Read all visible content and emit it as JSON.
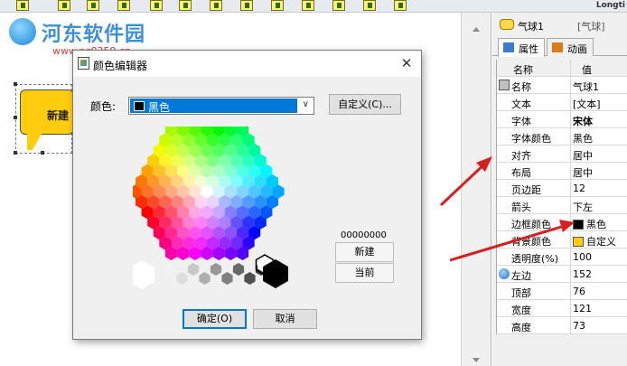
{
  "toolbar": {
    "right_text": "Longti"
  },
  "watermark": {
    "title": "河东软件园",
    "url": "www.pc0359.cn"
  },
  "canvas": {
    "balloon_text": "新建",
    "balloon_color": "#ffcc10"
  },
  "panel": {
    "object_name": "气球1",
    "object_type": "[气球]",
    "tabs": [
      {
        "label": "属性"
      },
      {
        "label": "动画"
      }
    ],
    "grid": {
      "headers": {
        "name": "名称",
        "value": "值"
      },
      "rows": [
        {
          "name": "名称",
          "value": "气球1"
        },
        {
          "name": "文本",
          "value": "[文本]"
        },
        {
          "name": "字体",
          "value": "宋体"
        },
        {
          "name": "字体颜色",
          "value": "黑色"
        },
        {
          "name": "对齐",
          "value": "居中"
        },
        {
          "name": "布局",
          "value": "居中"
        },
        {
          "name": "页边距",
          "value": "12"
        },
        {
          "name": "箭头",
          "value": "下左"
        },
        {
          "name": "边框颜色",
          "value": "黑色",
          "swatch": "#000000"
        },
        {
          "name": "背景颜色",
          "value": "自定义",
          "swatch": "#ffcc10"
        },
        {
          "name": "透明度(%)",
          "value": "100"
        },
        {
          "name": "左边",
          "value": "152"
        },
        {
          "name": "顶部",
          "value": "76"
        },
        {
          "name": "宽度",
          "value": "121"
        },
        {
          "name": "高度",
          "value": "73"
        }
      ]
    }
  },
  "dialog": {
    "title": "颜色编辑器",
    "close_glyph": "✕",
    "color_label": "颜色:",
    "selected_color": "黑色",
    "custom_button": "自定义(C)...",
    "hex_value": "00000000",
    "new_label": "新建",
    "current_label": "当前",
    "ok_button": "确定(O)",
    "cancel_button": "取消"
  },
  "colors": {
    "accent": "#0078d7",
    "arrow": "#d62020"
  }
}
